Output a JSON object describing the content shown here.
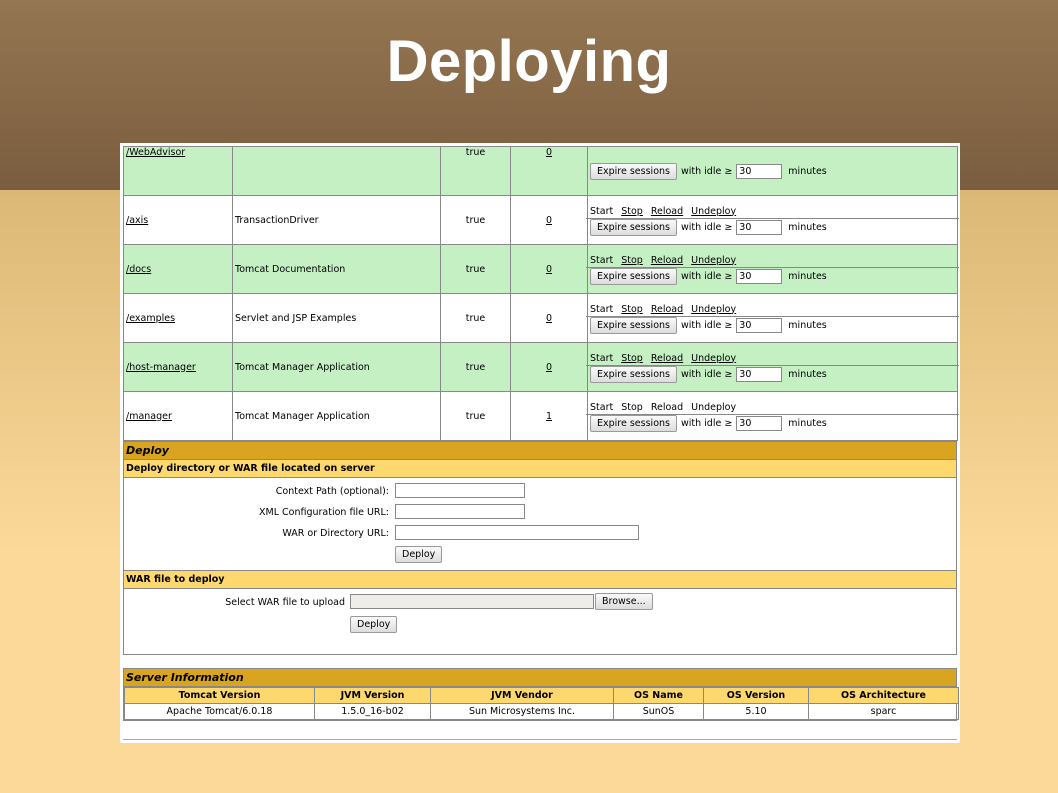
{
  "slide": {
    "title": "Deploying"
  },
  "apps": [
    {
      "path": "/WebAdvisor",
      "name": "",
      "running": "true",
      "sessions": "0",
      "green": true,
      "commands": []
    },
    {
      "path": "/axis",
      "name": "TransactionDriver",
      "running": "true",
      "sessions": "0",
      "green": false,
      "commands": [
        "Start",
        "Stop",
        "Reload",
        "Undeploy"
      ],
      "links": [
        false,
        true,
        true,
        true
      ]
    },
    {
      "path": "/docs",
      "name": "Tomcat Documentation",
      "running": "true",
      "sessions": "0",
      "green": true,
      "commands": [
        "Start",
        "Stop",
        "Reload",
        "Undeploy"
      ],
      "links": [
        false,
        true,
        true,
        true
      ]
    },
    {
      "path": "/examples",
      "name": "Servlet and JSP Examples",
      "running": "true",
      "sessions": "0",
      "green": false,
      "commands": [
        "Start",
        "Stop",
        "Reload",
        "Undeploy"
      ],
      "links": [
        false,
        true,
        true,
        true
      ]
    },
    {
      "path": "/host-manager",
      "name": "Tomcat Manager Application",
      "running": "true",
      "sessions": "0",
      "green": true,
      "commands": [
        "Start",
        "Stop",
        "Reload",
        "Undeploy"
      ],
      "links": [
        false,
        true,
        true,
        true
      ]
    },
    {
      "path": "/manager",
      "name": "Tomcat Manager Application",
      "running": "true",
      "sessions": "1",
      "green": false,
      "commands": [
        "Start",
        "Stop",
        "Reload",
        "Undeploy"
      ],
      "links": [
        false,
        false,
        false,
        false
      ]
    }
  ],
  "session_controls": {
    "expire_label": "Expire sessions",
    "with_idle": "with idle ≥",
    "idle_value": "30",
    "minutes": "minutes"
  },
  "deploy": {
    "heading": "Deploy",
    "server_heading": "Deploy directory or WAR file located on server",
    "context_path_label": "Context Path (optional):",
    "xml_config_label": "XML Configuration file URL:",
    "war_dir_label": "WAR or Directory URL:",
    "deploy_button": "Deploy",
    "war_heading": "WAR file to deploy",
    "select_war_label": "Select WAR file to upload",
    "browse_button": "Browse...",
    "deploy_button_2": "Deploy"
  },
  "server_info": {
    "heading": "Server Information",
    "columns": [
      "Tomcat Version",
      "JVM Version",
      "JVM Vendor",
      "OS Name",
      "OS Version",
      "OS Architecture"
    ],
    "values": [
      "Apache Tomcat/6.0.18",
      "1.5.0_16-b02",
      "Sun Microsystems Inc.",
      "SunOS",
      "5.10",
      "sparc"
    ]
  }
}
